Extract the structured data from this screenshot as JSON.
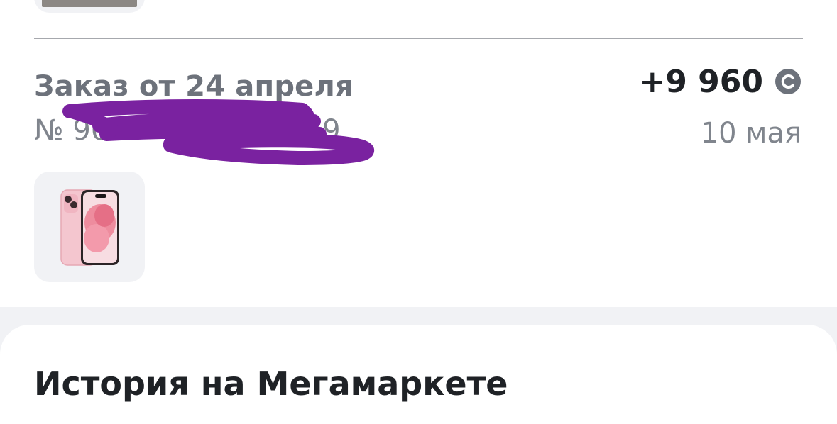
{
  "order": {
    "title": "Заказ от 24 апреля",
    "number_prefix": "№ 96",
    "number_tail": "919",
    "amount": "+9 960",
    "date": "10 мая",
    "bonus_icon": "sber-bonus-icon",
    "product_image": "iphone-pink-icon"
  },
  "history": {
    "title": "История на Мегамаркете"
  },
  "colors": {
    "scribble": "#7a22a0",
    "card_background": "#f1f2f5"
  }
}
